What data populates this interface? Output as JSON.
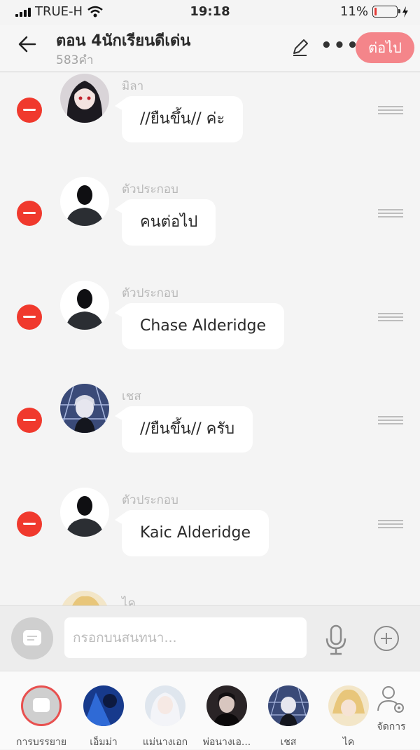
{
  "status_bar": {
    "carrier": "TRUE-H",
    "time": "19:18",
    "battery_text": "11%",
    "battery_level": 0.11
  },
  "header": {
    "title": "ตอน 4นักเรียนดีเด่น",
    "subtitle": "583คำ",
    "next_label": "ต่อไป"
  },
  "messages": [
    {
      "name": "มิลา",
      "text": "//ยืนขึ้น// ค่ะ",
      "avatar": "anime-girl-dark-hair"
    },
    {
      "name": "ตัวประกอบ",
      "text": "คนต่อไป",
      "avatar": "silhouette"
    },
    {
      "name": "ตัวประกอบ",
      "text": "Chase Alderidge",
      "avatar": "silhouette"
    },
    {
      "name": "เชส",
      "text": "//ยืนขึ้น// ครับ",
      "avatar": "anime-boy-white-hair"
    },
    {
      "name": "ตัวประกอบ",
      "text": "Kaic Alderidge",
      "avatar": "silhouette"
    },
    {
      "name": "ไค",
      "text": "",
      "avatar": "anime-boy-blonde"
    }
  ],
  "composer": {
    "placeholder": "กรอกบนสนทนา..."
  },
  "characters": [
    {
      "label": "การบรรยาย",
      "avatar": "narration"
    },
    {
      "label": "เอ็มม่า",
      "avatar": "blue-fantasy"
    },
    {
      "label": "แม่นางเอก",
      "avatar": "white-hair-woman"
    },
    {
      "label": "พ่อนางเอ...",
      "avatar": "dark-man"
    },
    {
      "label": "เชส",
      "avatar": "anime-boy-white-hair"
    },
    {
      "label": "ไค",
      "avatar": "anime-boy-blonde"
    }
  ],
  "manage_label": "จัดการ",
  "colors": {
    "accent": "#f4858a",
    "delete": "#f0392d",
    "active_ring": "#e8504f"
  }
}
